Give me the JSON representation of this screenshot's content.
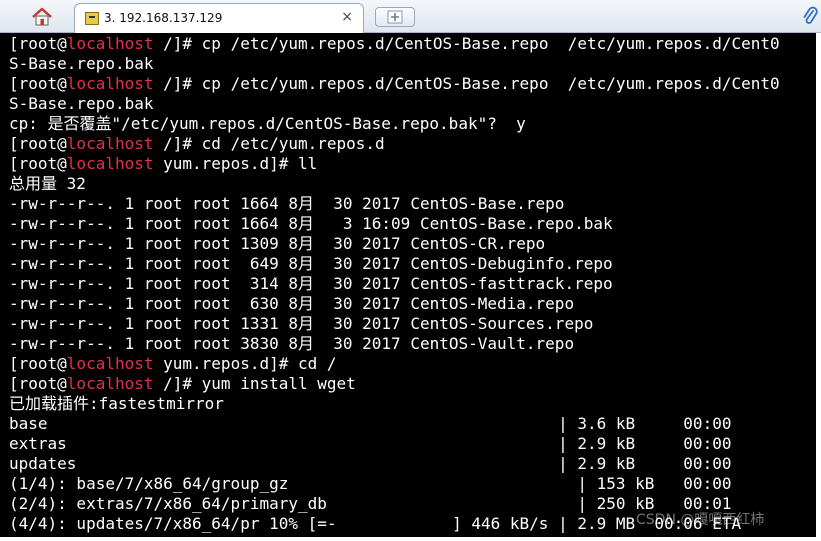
{
  "tabbar": {
    "home_icon": "home-icon",
    "tab_title": "3. 192.168.137.129",
    "close_glyph": "×",
    "new_tab_icon": "new-tab-plus-icon",
    "attach_icon": "paperclip-icon"
  },
  "prompt": {
    "user": "[root@",
    "host": "localhost"
  },
  "terminal": {
    "lines": [
      {
        "type": "prompt",
        "rest": " /]# cp /etc/yum.repos.d/CentOS-Base.repo  /etc/yum.repos.d/Cent0"
      },
      {
        "type": "text",
        "text": "S-Base.repo.bak"
      },
      {
        "type": "prompt",
        "rest": " /]# cp /etc/yum.repos.d/CentOS-Base.repo  /etc/yum.repos.d/Cent0"
      },
      {
        "type": "text",
        "text": "S-Base.repo.bak"
      },
      {
        "type": "text",
        "text": "cp: 是否覆盖\"/etc/yum.repos.d/CentOS-Base.repo.bak\"?  y"
      },
      {
        "type": "prompt",
        "rest": " /]# cd /etc/yum.repos.d"
      },
      {
        "type": "prompt",
        "rest": " yum.repos.d]# ll"
      },
      {
        "type": "text",
        "text": "总用量 32"
      },
      {
        "type": "text",
        "text": "-rw-r--r--. 1 root root 1664 8月  30 2017 CentOS-Base.repo"
      },
      {
        "type": "text",
        "text": "-rw-r--r--. 1 root root 1664 8月   3 16:09 CentOS-Base.repo.bak"
      },
      {
        "type": "text",
        "text": "-rw-r--r--. 1 root root 1309 8月  30 2017 CentOS-CR.repo"
      },
      {
        "type": "text",
        "text": "-rw-r--r--. 1 root root  649 8月  30 2017 CentOS-Debuginfo.repo"
      },
      {
        "type": "text",
        "text": "-rw-r--r--. 1 root root  314 8月  30 2017 CentOS-fasttrack.repo"
      },
      {
        "type": "text",
        "text": "-rw-r--r--. 1 root root  630 8月  30 2017 CentOS-Media.repo"
      },
      {
        "type": "text",
        "text": "-rw-r--r--. 1 root root 1331 8月  30 2017 CentOS-Sources.repo"
      },
      {
        "type": "text",
        "text": "-rw-r--r--. 1 root root 3830 8月  30 2017 CentOS-Vault.repo"
      },
      {
        "type": "prompt",
        "rest": " yum.repos.d]# cd /"
      },
      {
        "type": "prompt",
        "rest": " /]# yum install wget"
      },
      {
        "type": "text",
        "text": "已加载插件:fastestmirror"
      },
      {
        "type": "text",
        "text": "base                                                     | 3.6 kB     00:00"
      },
      {
        "type": "text",
        "text": "extras                                                   | 2.9 kB     00:00"
      },
      {
        "type": "text",
        "text": "updates                                                  | 2.9 kB     00:00"
      },
      {
        "type": "text",
        "text": "(1/4): base/7/x86_64/group_gz                              | 153 kB   00:00"
      },
      {
        "type": "text",
        "text": "(2/4): extras/7/x86_64/primary_db                          | 250 kB   00:01"
      },
      {
        "type": "text",
        "text": "(4/4): updates/7/x86_64/pr 10% [=-            ] 446 kB/s | 2.9 MB  00:06 ETA"
      }
    ]
  },
  "watermark": "CSDN @嘎嘎西红柿"
}
